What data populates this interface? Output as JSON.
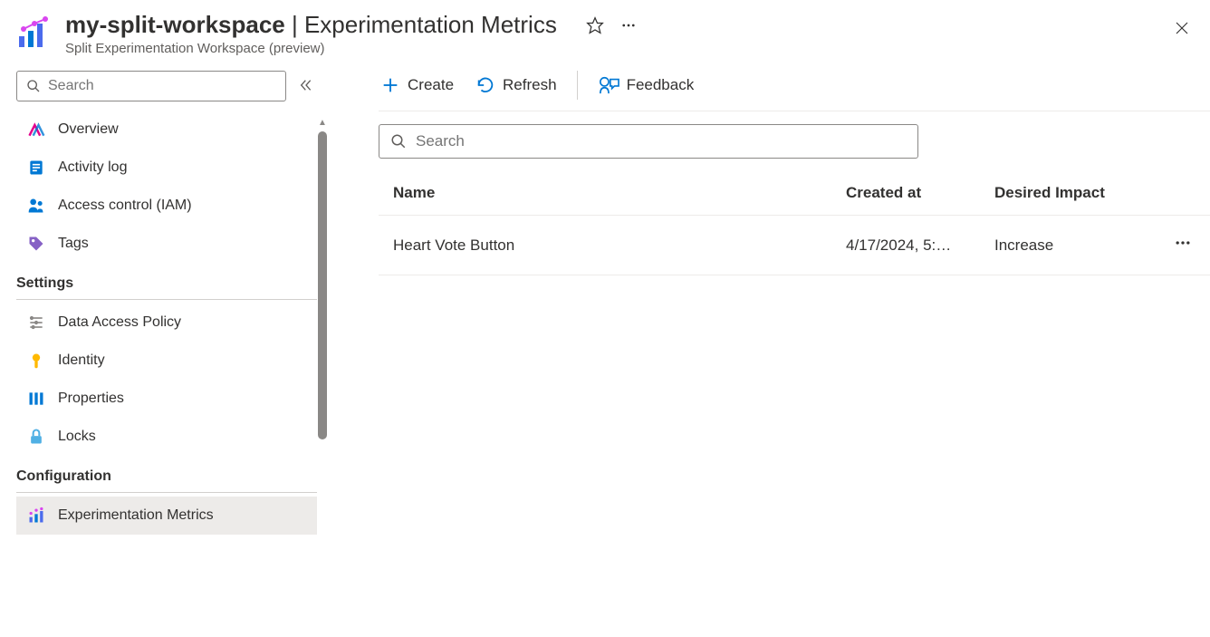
{
  "header": {
    "workspace_name": "my-split-workspace",
    "separator": " | ",
    "page_name": "Experimentation Metrics",
    "subtitle": "Split Experimentation Workspace (preview)"
  },
  "sidebar": {
    "search_placeholder": "Search",
    "items": [
      {
        "label": "Overview"
      },
      {
        "label": "Activity log"
      },
      {
        "label": "Access control (IAM)"
      },
      {
        "label": "Tags"
      }
    ],
    "sections": [
      {
        "title": "Settings",
        "items": [
          {
            "label": "Data Access Policy"
          },
          {
            "label": "Identity"
          },
          {
            "label": "Properties"
          },
          {
            "label": "Locks"
          }
        ]
      },
      {
        "title": "Configuration",
        "items": [
          {
            "label": "Experimentation Metrics"
          }
        ]
      }
    ]
  },
  "toolbar": {
    "create": "Create",
    "refresh": "Refresh",
    "feedback": "Feedback"
  },
  "main": {
    "search_placeholder": "Search",
    "columns": {
      "name": "Name",
      "created_at": "Created at",
      "desired_impact": "Desired Impact"
    },
    "rows": [
      {
        "name": "Heart Vote Button",
        "created_at": "4/17/2024, 5:…",
        "desired_impact": "Increase"
      }
    ]
  }
}
